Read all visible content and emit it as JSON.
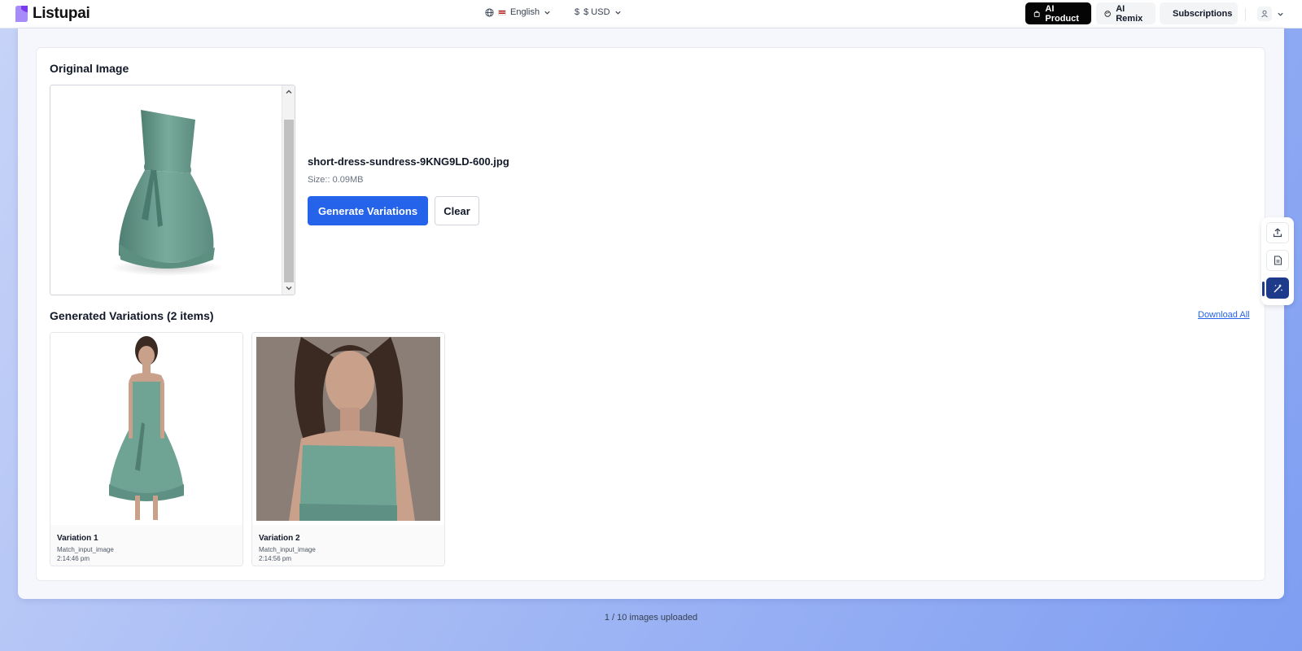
{
  "header": {
    "logo_text": "Listupai",
    "language": "English",
    "currency": "$ USD",
    "currency_symbol": "$",
    "nav": {
      "ai_product": "AI Product",
      "ai_remix": "AI Remix",
      "subscriptions": "Subscriptions"
    },
    "brand_color": "#8b5cf6"
  },
  "original": {
    "title": "Original Image",
    "file_name": "short-dress-sundress-9KNG9LD-600.jpg",
    "file_size": "Size:: 0.09MB",
    "generate_label": "Generate Variations",
    "clear_label": "Clear"
  },
  "generated": {
    "title": "Generated Variations (2 items)",
    "download_all": "Download All",
    "items": [
      {
        "title": "Variation 1",
        "mode": "Match_input_image",
        "time": "2:14:46 pm"
      },
      {
        "title": "Variation 2",
        "mode": "Match_input_image",
        "time": "2:14:56 pm"
      }
    ]
  },
  "side_tools": [
    "upload-icon",
    "document-icon",
    "magic-wand-icon"
  ],
  "footer": {
    "status": "1 / 10 images uploaded"
  },
  "colors": {
    "primary": "#2563eb",
    "active_tool": "#1e3a8a",
    "dress": "#6fa394"
  }
}
